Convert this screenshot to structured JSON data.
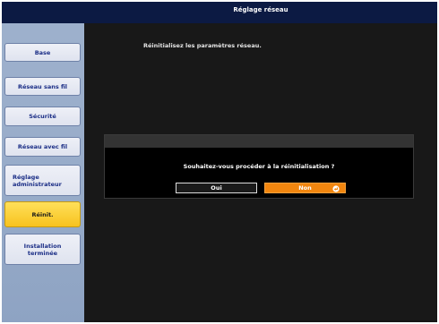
{
  "title": "Réglage réseau",
  "instruction": "Réinitialisez les paramètres réseau.",
  "sidebar": {
    "items": [
      {
        "label": "Base"
      },
      {
        "label": "Réseau sans fil"
      },
      {
        "label": "Sécurité"
      },
      {
        "label": "Réseau avec fil"
      },
      {
        "label_line1": "Réglage",
        "label_line2": "administrateur"
      },
      {
        "label": "Réinit.",
        "active": true
      },
      {
        "label_line1": "Installation",
        "label_line2": "terminée"
      }
    ]
  },
  "dialog": {
    "question": "Souhaitez-vous procéder à la réinitialisation ?",
    "yes_label": "Oui",
    "no_label": "Non",
    "no_icon": "enter-icon"
  },
  "colors": {
    "title_bar": "#0c1a43",
    "sidebar": "#9eb1cd",
    "active_item": "#f7c21e",
    "selected_button": "#f2860f"
  }
}
